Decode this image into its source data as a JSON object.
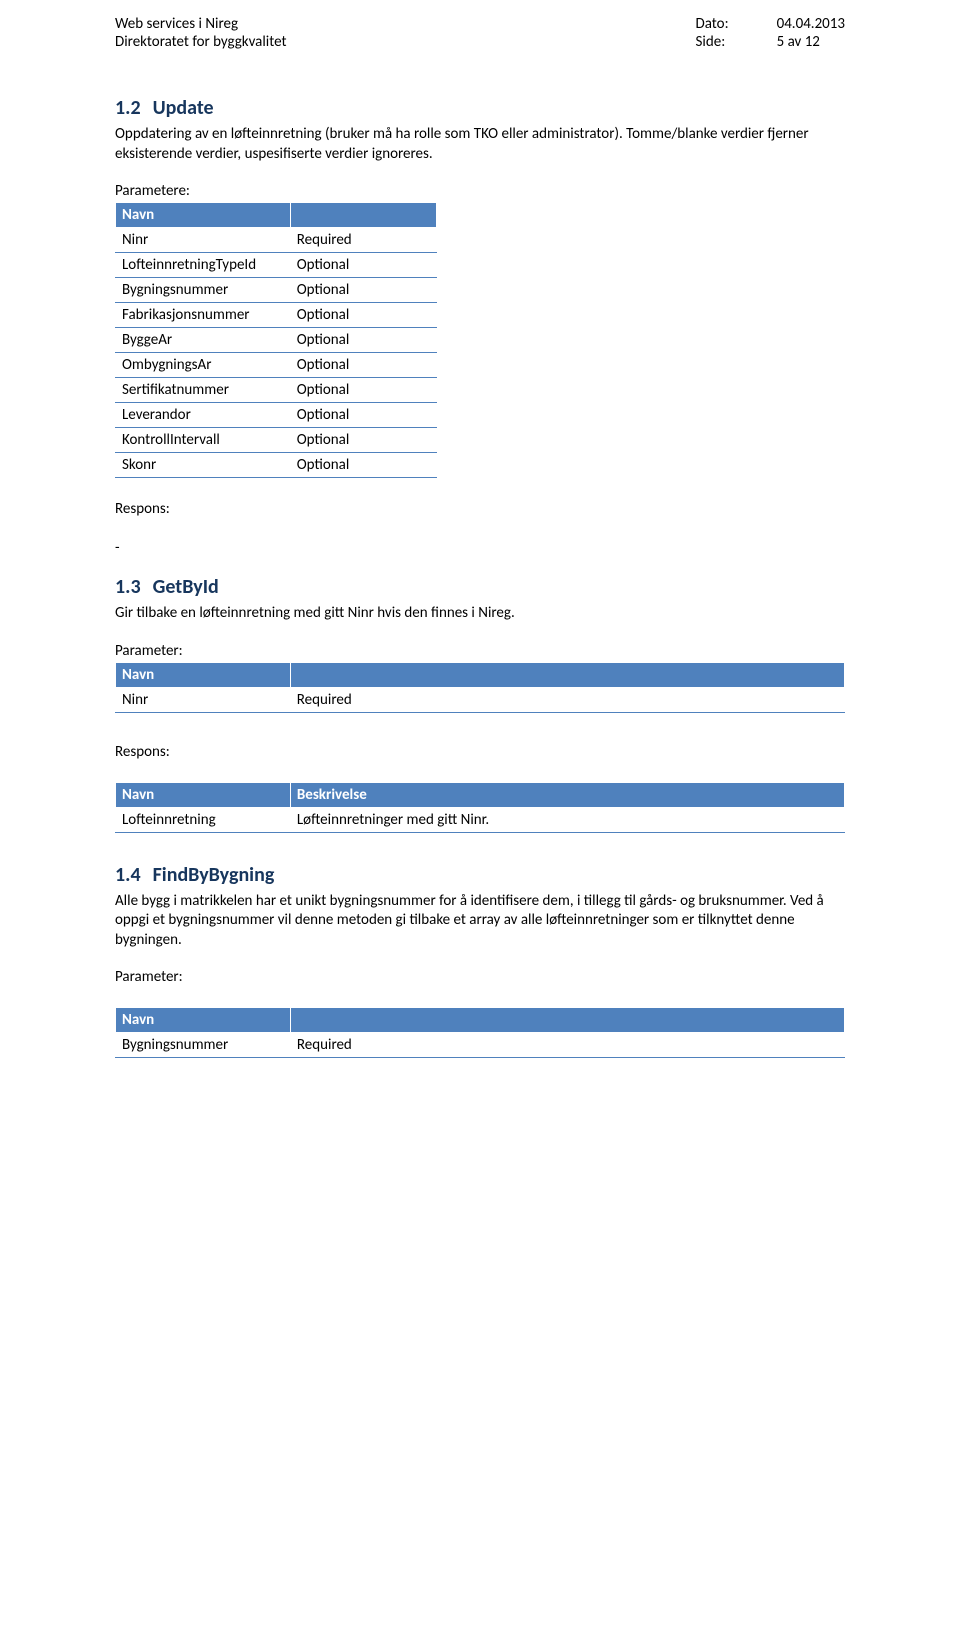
{
  "header": {
    "left1": "Web services i Nireg",
    "left2": "Direktoratet for byggkvalitet",
    "dato_label": "Dato:",
    "dato_value": "04.04.2013",
    "side_label": "Side:",
    "side_value": "5 av 12"
  },
  "s12": {
    "num": "1.2",
    "title": "Update",
    "desc": "Oppdatering av en løfteinnretning (bruker må ha rolle som TKO eller administrator). Tomme/blanke verdier fjerner eksisterende verdier, uspesifiserte verdier ignoreres.",
    "param_label": "Parametere:",
    "th1": "Navn",
    "th2": "",
    "rows": [
      {
        "a": "Ninr",
        "b": "Required"
      },
      {
        "a": "LofteinnretningTypeId",
        "b": "Optional"
      },
      {
        "a": "Bygningsnummer",
        "b": "Optional"
      },
      {
        "a": "Fabrikasjonsnummer",
        "b": "Optional"
      },
      {
        "a": "ByggeAr",
        "b": "Optional"
      },
      {
        "a": "OmbygningsAr",
        "b": "Optional"
      },
      {
        "a": "Sertifikatnummer",
        "b": "Optional"
      },
      {
        "a": "Leverandor",
        "b": "Optional"
      },
      {
        "a": "KontrollIntervall",
        "b": "Optional"
      },
      {
        "a": "Skonr",
        "b": "Optional"
      }
    ],
    "respons_label": "Respons:",
    "dash": "-"
  },
  "s13": {
    "num": "1.3",
    "title": "GetById",
    "desc": "Gir tilbake en løfteinnretning med gitt Ninr hvis den finnes i Nireg.",
    "param_label": "Parameter:",
    "t1_th1": "Navn",
    "t1_th2": "",
    "t1_rows": [
      {
        "a": "Ninr",
        "b": "Required"
      }
    ],
    "respons_label": "Respons:",
    "t2_th1": "Navn",
    "t2_th2": "Beskrivelse",
    "t2_rows": [
      {
        "a": "Lofteinnretning",
        "b": "Løfteinnretninger med gitt Ninr."
      }
    ]
  },
  "s14": {
    "num": "1.4",
    "title": "FindByBygning",
    "desc": "Alle bygg i matrikkelen har et unikt bygningsnummer for å identifisere dem, i tillegg til gårds- og bruksnummer. Ved å oppgi et bygningsnummer vil denne metoden gi tilbake et array av alle løfteinnretninger som er tilknyttet denne bygningen.",
    "param_label": "Parameter:",
    "th1": "Navn",
    "th2": "",
    "rows": [
      {
        "a": "Bygningsnummer",
        "b": "Required"
      }
    ]
  }
}
